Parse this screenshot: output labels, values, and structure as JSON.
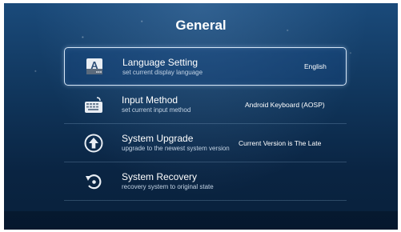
{
  "header": {
    "title": "General"
  },
  "items": [
    {
      "label": "Language Setting",
      "subtitle": "set current display language",
      "value": "English",
      "icon": "language-a-icon"
    },
    {
      "label": "Input Method",
      "subtitle": "set current input method",
      "value": "Android Keyboard (AOSP)",
      "icon": "keyboard-icon"
    },
    {
      "label": "System Upgrade",
      "subtitle": "upgrade to the newest system version",
      "value": "Current Version is The Late",
      "icon": "upgrade-arrow-icon"
    },
    {
      "label": "System Recovery",
      "subtitle": "recovery system to original state",
      "value": "",
      "icon": "recovery-icon"
    }
  ],
  "colors": {
    "background": "#0f3358",
    "highlight_border": "#d6e6f7",
    "text": "#ffffff",
    "subtext": "#c3d3e4"
  }
}
